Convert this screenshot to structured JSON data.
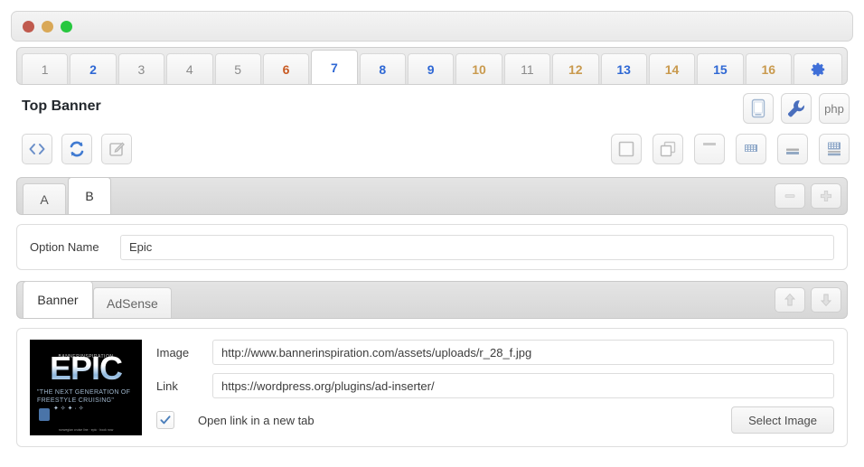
{
  "window": {
    "dots": [
      "close-red",
      "minimize-yellow",
      "maximize-green"
    ]
  },
  "block_tabs": {
    "items": [
      {
        "label": "1",
        "color_class": "c-grey",
        "active": false
      },
      {
        "label": "2",
        "color_class": "c-blue",
        "active": false
      },
      {
        "label": "3",
        "color_class": "c-grey",
        "active": false
      },
      {
        "label": "4",
        "color_class": "c-grey",
        "active": false
      },
      {
        "label": "5",
        "color_class": "c-grey",
        "active": false
      },
      {
        "label": "6",
        "color_class": "c-orange",
        "active": false
      },
      {
        "label": "7",
        "color_class": "c-blue",
        "active": true
      },
      {
        "label": "8",
        "color_class": "c-blue",
        "active": false
      },
      {
        "label": "9",
        "color_class": "c-blue",
        "active": false
      },
      {
        "label": "10",
        "color_class": "c-tan",
        "active": false
      },
      {
        "label": "11",
        "color_class": "c-grey",
        "active": false
      },
      {
        "label": "12",
        "color_class": "c-tan",
        "active": false
      },
      {
        "label": "13",
        "color_class": "c-blue",
        "active": false
      },
      {
        "label": "14",
        "color_class": "c-tan",
        "active": false
      },
      {
        "label": "15",
        "color_class": "c-blue",
        "active": false
      },
      {
        "label": "16",
        "color_class": "c-tan",
        "active": false
      }
    ],
    "settings_icon": "gear-icon"
  },
  "header": {
    "title": "Top Banner",
    "left_tools": [
      {
        "icon": "code-brackets-icon",
        "accent": "#4a7ebb"
      },
      {
        "icon": "sync-refresh-icon",
        "accent": "#4a7ebb"
      },
      {
        "icon": "edit-pencil-icon",
        "accent": "#b4b4b4"
      }
    ],
    "right_top_tools": [
      {
        "icon": "mobile-device-icon",
        "accent": "#8aa8cc"
      },
      {
        "icon": "wrench-icon",
        "accent": "#4a6fbd"
      },
      {
        "icon": "php-icon",
        "label": "php",
        "accent": "#7a7a7a"
      }
    ],
    "right_bottom_tools": [
      {
        "icon": "frame-square-icon"
      },
      {
        "icon": "stacked-windows-icon"
      },
      {
        "icon": "header-bar-icon"
      },
      {
        "icon": "content-grid-icon"
      },
      {
        "icon": "footer-bar-icon"
      },
      {
        "icon": "full-layout-icon"
      }
    ]
  },
  "ab_tabs": {
    "items": [
      {
        "label": "A",
        "active": false
      },
      {
        "label": "B",
        "active": true
      }
    ],
    "remove_label": "–",
    "add_label": "＋"
  },
  "option": {
    "label": "Option Name",
    "value": "Epic",
    "placeholder": ""
  },
  "content_tabs": {
    "items": [
      {
        "label": "Banner",
        "active": true
      },
      {
        "label": "AdSense",
        "active": false
      }
    ],
    "move_up_icon": "arrow-up-icon",
    "move_down_icon": "arrow-down-icon"
  },
  "banner": {
    "thumbnail": {
      "brand": "BANNERINSPIRATION",
      "title": "EPIC",
      "tagline": "\"THE NEXT GENERATION OF FREESTYLE CRUISING\"",
      "footer": "norwegian cruise line · epic · book now"
    },
    "image_label": "Image",
    "image_value": "http://www.bannerinspiration.com/assets/uploads/r_28_f.jpg",
    "link_label": "Link",
    "link_value": "https://wordpress.org/plugins/ad-inserter/",
    "new_tab_label": "Open link in a new tab",
    "new_tab_checked": true,
    "select_image_label": "Select Image"
  },
  "colors": {
    "accent_blue": "#2f68d4",
    "icon_blue": "#4a7ebb",
    "tab_orange": "#c85a22",
    "tab_tan": "#c99a4e",
    "tab_grey": "#8b8b8b"
  }
}
